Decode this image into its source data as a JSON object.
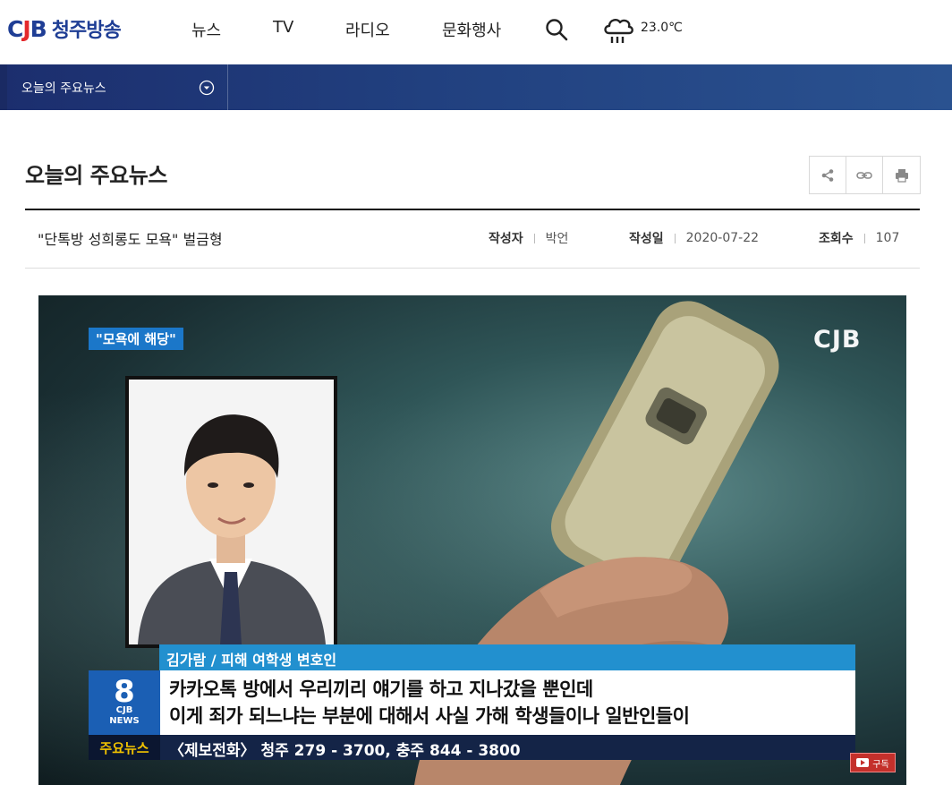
{
  "header": {
    "logo_mark": {
      "c": "C",
      "j": "J",
      "b": "B"
    },
    "logo_name": "청주방송",
    "nav": [
      "뉴스",
      "TV",
      "라디오",
      "문화행사"
    ],
    "weather": {
      "icon": "rain-cloud-icon",
      "temperature": "23.0℃"
    }
  },
  "subnav": {
    "current": "오늘의 주요뉴스",
    "dropdown_icon": "chevron-down-circle-icon"
  },
  "page": {
    "title": "오늘의 주요뉴스",
    "tools": [
      "share-icon",
      "link-icon",
      "print-icon"
    ]
  },
  "article": {
    "title": "\"단톡방 성희롱도 모욕\" 벌금형",
    "author_label": "작성자",
    "author": "박언",
    "date_label": "작성일",
    "date": "2020-07-22",
    "views_label": "조회수",
    "views": "107"
  },
  "video": {
    "tag": "\"모욕에 해당\"",
    "watermark": "CJB",
    "speaker": "김가람 / 피해 여학생 변호인",
    "program_logo": {
      "number": "8",
      "brand": "CJB",
      "sub": "NEWS"
    },
    "caption_lines": [
      "카카오톡 방에서 우리끼리 얘기를 하고 지나갔을 뿐인데",
      "이게 죄가 되느냐는 부분에 대해서 사실 가해 학생들이나 일반인들이"
    ],
    "ticker_tag": "주요뉴스",
    "ticker": "〈제보전화〉 청주 279 - 3700, 충주 844 - 3800",
    "subscribe_label": "구독"
  },
  "colors": {
    "brand_blue": "#1f3e95",
    "brand_red": "#e4282c",
    "subnav": "#21407f",
    "caption_blue": "#2290cf"
  }
}
